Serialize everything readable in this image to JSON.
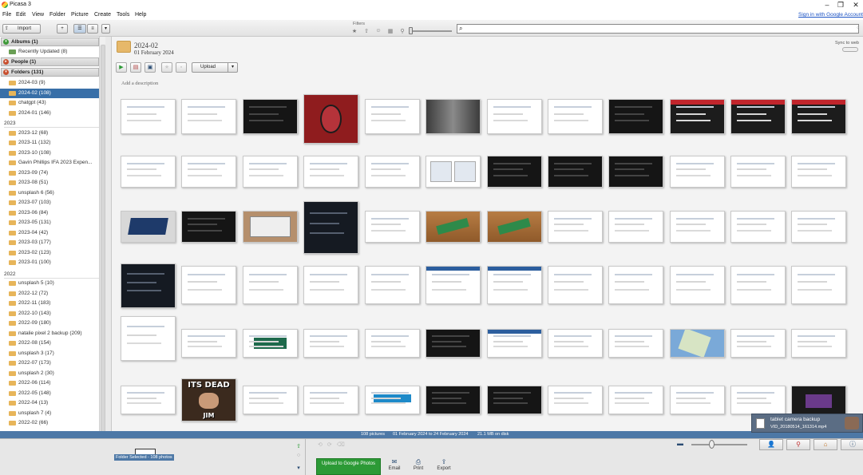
{
  "window": {
    "title": "Picasa 3",
    "minimize": "–",
    "maximize": "❐",
    "close": "✕"
  },
  "menu": [
    "File",
    "Edit",
    "View",
    "Folder",
    "Picture",
    "Create",
    "Tools",
    "Help"
  ],
  "signin_link": "Sign in with Google Account",
  "toolbar": {
    "import_label": "Import",
    "filters_label": "Filters"
  },
  "left_panel": {
    "albums_header": "Albums (1)",
    "albums": [
      {
        "label": "Recently Updated (8)"
      }
    ],
    "people_header": "People (1)",
    "folders_header": "Folders (131)",
    "folders_2024": [
      {
        "label": "2024-03 (9)"
      },
      {
        "label": "2024-02 (108)",
        "selected": true
      },
      {
        "label": "chatgpt (43)"
      },
      {
        "label": "2024-01 (146)"
      }
    ],
    "year_2023": "2023",
    "folders_2023": [
      {
        "label": "2023-12 (68)"
      },
      {
        "label": "2023-11 (132)"
      },
      {
        "label": "2023-10 (108)"
      },
      {
        "label": "Gavin Phillips IFA 2023 Expen..."
      },
      {
        "label": "2023-09 (74)"
      },
      {
        "label": "2023-08 (51)"
      },
      {
        "label": "unsplash 6 (56)"
      },
      {
        "label": "2023-07 (103)"
      },
      {
        "label": "2023-06 (84)"
      },
      {
        "label": "2023-05 (131)"
      },
      {
        "label": "2023-04 (42)"
      },
      {
        "label": "2023-03 (177)"
      },
      {
        "label": "2023-02 (123)"
      },
      {
        "label": "2023-01 (100)"
      }
    ],
    "year_2022": "2022",
    "folders_2022": [
      {
        "label": "unsplash 5 (10)"
      },
      {
        "label": "2022-12 (72)"
      },
      {
        "label": "2022-11 (183)"
      },
      {
        "label": "2022-10 (143)"
      },
      {
        "label": "2022-09 (180)"
      },
      {
        "label": "natalie pixel 2 backup (209)"
      },
      {
        "label": "2022-08 (154)"
      },
      {
        "label": "unsplash 3 (17)"
      },
      {
        "label": "2022-07 (173)"
      },
      {
        "label": "unsplash 2 (30)"
      },
      {
        "label": "2022-06 (114)"
      },
      {
        "label": "2022-05 (148)"
      },
      {
        "label": "2022-04 (13)"
      },
      {
        "label": "unsplash 7 (4)"
      },
      {
        "label": "2022-02 (66)"
      }
    ]
  },
  "main": {
    "folder_title": "2024-02",
    "folder_date": "01 February 2024",
    "sync_label": "Sync to web",
    "upload_label": "Upload",
    "add_description": "Add a description",
    "meme_top": "ITS DEAD",
    "meme_bottom": "JIM"
  },
  "status": {
    "count": "108 pictures",
    "range": "01 February 2024 to 24 February 2024",
    "size": "21.1 MB on disk"
  },
  "notification": {
    "title": "tablet camera backup",
    "file": "VID_20180514_161314.mp4"
  },
  "bottom": {
    "tray_label": "Folder Selected - 108 photos",
    "upload_google": "Upload to Google Photos",
    "email": "Email",
    "print": "Print",
    "export": "Export"
  }
}
